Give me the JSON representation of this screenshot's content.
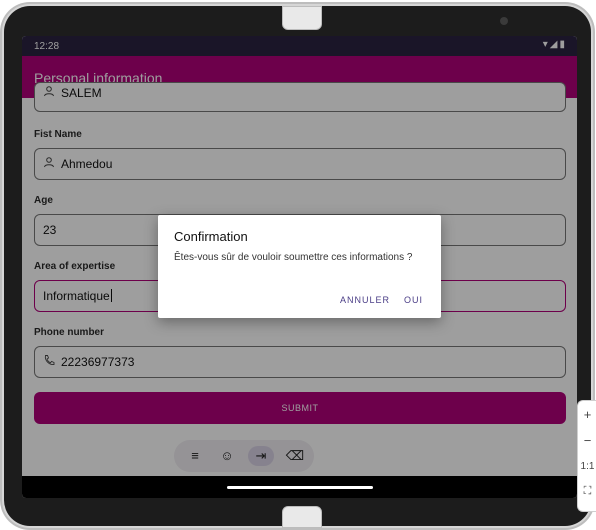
{
  "status": {
    "time": "12:28",
    "icons": "▾◢▮"
  },
  "appbar": {
    "title": "Personal information"
  },
  "form": {
    "fields": [
      {
        "label": "",
        "value": "SALEM"
      },
      {
        "label": "Fist Name",
        "value": "Ahmedou"
      },
      {
        "label": "Age",
        "value": "23"
      },
      {
        "label": "Area of expertise",
        "value": "Informatique"
      },
      {
        "label": "Phone number",
        "value": "22236977373"
      }
    ],
    "submit_label": "SUBMIT"
  },
  "keyboard_toolbar": {
    "keys": [
      "≡",
      "☺",
      "⇥",
      "⌫"
    ]
  },
  "dialog": {
    "title": "Confirmation",
    "message": "Êtes-vous sûr de vouloir soumettre ces informations ?",
    "cancel_label": "ANNULER",
    "confirm_label": "OUI"
  },
  "side_toolbar": {
    "zoom_in": "+",
    "zoom_out": "−",
    "ratio": "1:1",
    "fit": "⛶"
  },
  "colors": {
    "accent": "#b1007a",
    "statusbar": "#2b2342",
    "dialog_button": "#4a3d86"
  }
}
